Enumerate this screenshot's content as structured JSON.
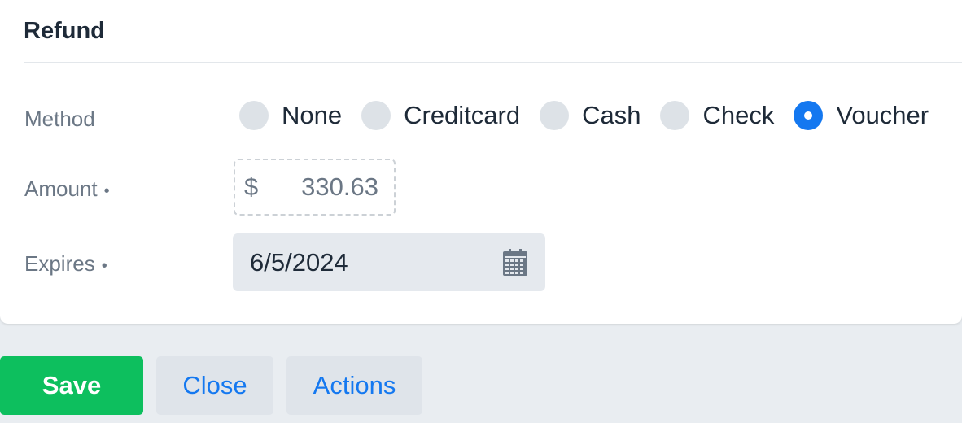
{
  "card": {
    "title": "Refund"
  },
  "method": {
    "label": "Method",
    "options": [
      "None",
      "Creditcard",
      "Cash",
      "Check",
      "Voucher"
    ],
    "selected": "Voucher"
  },
  "amount": {
    "label": "Amount",
    "required_marker": "•",
    "currency": "$",
    "value": "330.63"
  },
  "expires": {
    "label": "Expires",
    "required_marker": "•",
    "value": "6/5/2024",
    "icon": "calendar-icon"
  },
  "footer": {
    "save_label": "Save",
    "close_label": "Close",
    "actions_label": "Actions"
  },
  "colors": {
    "accent": "#1478f0",
    "save": "#0dbf5e"
  }
}
